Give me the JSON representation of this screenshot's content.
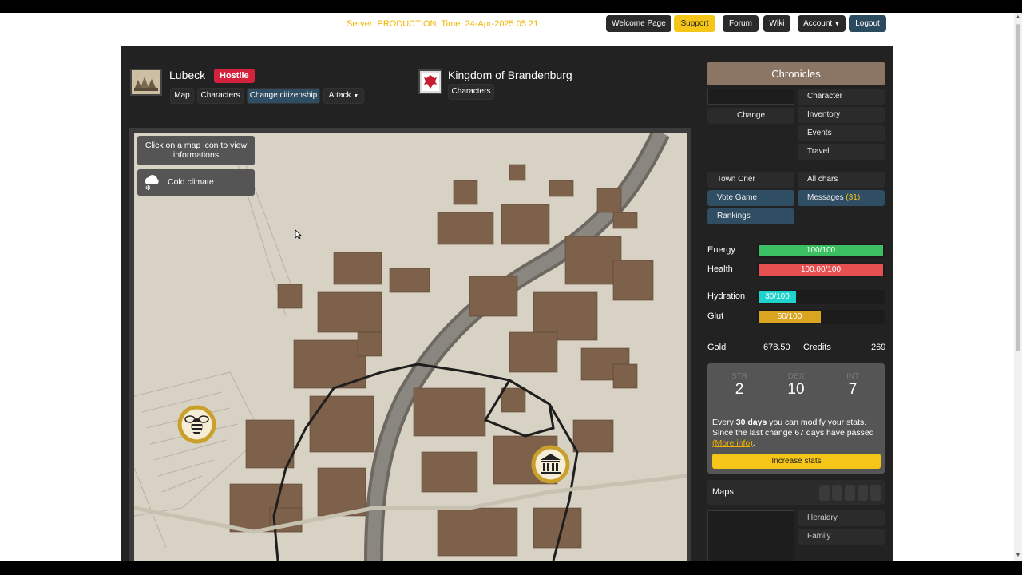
{
  "server_line": "Server: PRODUCTION, Time: 24-Apr-2025 05:21",
  "nav": {
    "welcome": "Welcome Page",
    "support": "Support",
    "forum": "Forum",
    "wiki": "Wiki",
    "account": "Account",
    "logout": "Logout"
  },
  "town": {
    "name": "Lubeck",
    "status": "Hostile",
    "buttons": {
      "map": "Map",
      "characters": "Characters",
      "citizenship": "Change citizenship",
      "attack": "Attack"
    }
  },
  "kingdom": {
    "name": "Kingdom of Brandenburg",
    "characters": "Characters"
  },
  "map": {
    "info": "Click on a map icon to view informations",
    "climate": "Cold climate"
  },
  "sidebar": {
    "title": "Chronicles",
    "change": "Change",
    "character": "Character",
    "inventory": "Inventory",
    "events": "Events",
    "travel": "Travel",
    "town_crier": "Town Crier",
    "all_chars": "All chars",
    "vote_game": "Vote Game",
    "messages": "Messages",
    "messages_count": "(31)",
    "rankings": "Rankings"
  },
  "vitals": {
    "energy": {
      "label": "Energy",
      "text": "100/100",
      "fraction": 1.0,
      "color": "#3cbf62"
    },
    "health": {
      "label": "Health",
      "text": "100.00/100",
      "fraction": 1.0,
      "color": "#e65050"
    },
    "hydration": {
      "label": "Hydration",
      "text": "30/100",
      "fraction": 0.3,
      "color": "#1dd3cc"
    },
    "glut": {
      "label": "Glut",
      "text": "50/100",
      "fraction": 0.5,
      "color": "#d9a520"
    }
  },
  "currency": {
    "gold_label": "Gold",
    "gold": "678.50",
    "credits_label": "Credits",
    "credits": "269"
  },
  "stats": {
    "str_label": "STR",
    "str": "2",
    "dex_label": "DEX",
    "dex": "10",
    "int_label": "INT",
    "int": "7",
    "every": "Every ",
    "days": "30 days",
    "modify": " you can modify your stats.",
    "since": "Since the last change 67 days have passed",
    "more_info": "(More info)",
    "period": ".",
    "increase": "Increase stats"
  },
  "maps_label": "Maps",
  "heraldry": "Heraldry",
  "family": "Family"
}
